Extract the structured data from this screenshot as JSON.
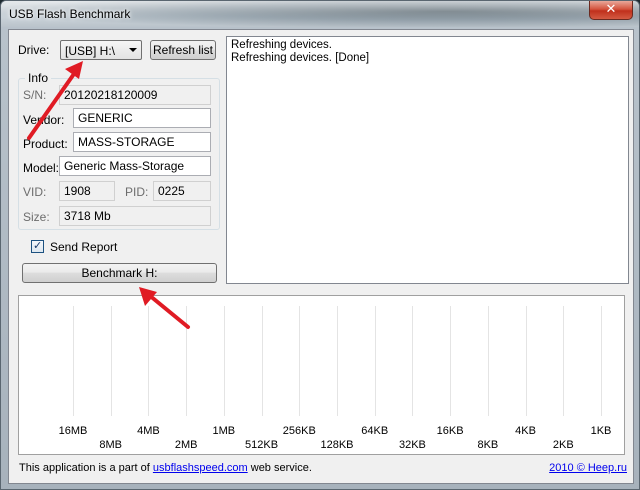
{
  "window": {
    "title": "USB Flash Benchmark",
    "close_glyph": "✕"
  },
  "drive": {
    "label": "Drive:",
    "selected": "[USB] H:\\",
    "refresh_label": "Refresh list"
  },
  "info": {
    "group_title": "Info",
    "sn_label": "S/N:",
    "sn_value": "20120218120009",
    "vendor_label": "Vendor:",
    "vendor_value": "GENERIC",
    "product_label": "Product:",
    "product_value": "MASS-STORAGE",
    "model_label": "Model:",
    "model_value": "Generic Mass-Storage",
    "vid_label": "VID:",
    "vid_value": "1908",
    "pid_label": "PID:",
    "pid_value": "0225",
    "size_label": "Size:",
    "size_value": "3718 Mb"
  },
  "send_report": {
    "label": "Send Report",
    "checked": true,
    "check_glyph": "✓"
  },
  "benchmark_button": "Benchmark H:",
  "log": {
    "lines": [
      "Refreshing devices.",
      "Refreshing devices. [Done]"
    ]
  },
  "chart_data": {
    "type": "line",
    "x_upper": [
      "16MB",
      "4MB",
      "1MB",
      "256KB",
      "64KB",
      "16KB",
      "4KB",
      "1KB"
    ],
    "x_lower": [
      "8MB",
      "2MB",
      "512KB",
      "128KB",
      "32KB",
      "8KB",
      "2KB"
    ],
    "series": []
  },
  "footer": {
    "prefix": "This application is a part of ",
    "link": "usbflashspeed.com",
    "suffix": " web service.",
    "copyright": "2010 © Heep.ru"
  },
  "annotation_color": "#e01b24"
}
